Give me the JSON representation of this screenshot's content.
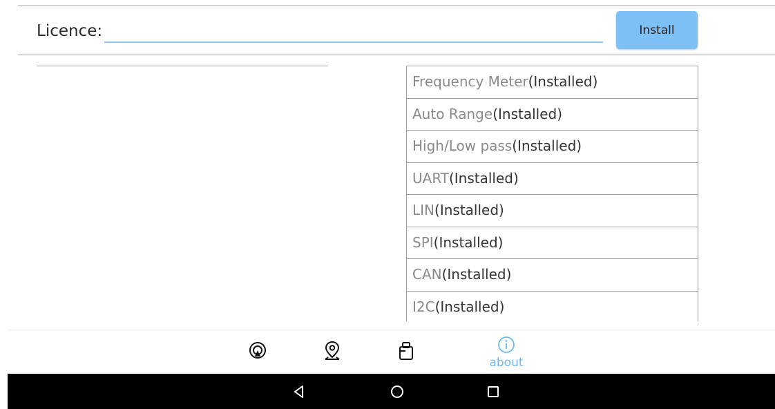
{
  "licence": {
    "label": "Licence:",
    "value": "",
    "placeholder": ""
  },
  "install_button": {
    "label": "Install"
  },
  "modules": [
    {
      "name": "Frequency Meter",
      "status": "(Installed)"
    },
    {
      "name": "Auto Range",
      "status": "(Installed)"
    },
    {
      "name": "High/Low pass",
      "status": "(Installed)"
    },
    {
      "name": "UART",
      "status": "(Installed)"
    },
    {
      "name": "LIN",
      "status": "(Installed)"
    },
    {
      "name": "SPI",
      "status": "(Installed)"
    },
    {
      "name": "CAN",
      "status": "(Installed)"
    },
    {
      "name": "I2C",
      "status": "(Installed)"
    }
  ],
  "bottom_nav": {
    "items": [
      {
        "icon": "scope-icon",
        "label": ""
      },
      {
        "icon": "location-pin-icon",
        "label": ""
      },
      {
        "icon": "device-icon",
        "label": ""
      },
      {
        "icon": "info-icon",
        "label": "about",
        "active": true
      }
    ]
  },
  "system_nav": {
    "items": [
      "back-icon",
      "home-icon",
      "recents-icon"
    ]
  },
  "colors": {
    "accent": "#7cc0f5",
    "active_nav": "#6fb8ee",
    "input_underline": "#8fc7ef",
    "system_bar": "#000000",
    "divider": "#9c9c9c"
  }
}
